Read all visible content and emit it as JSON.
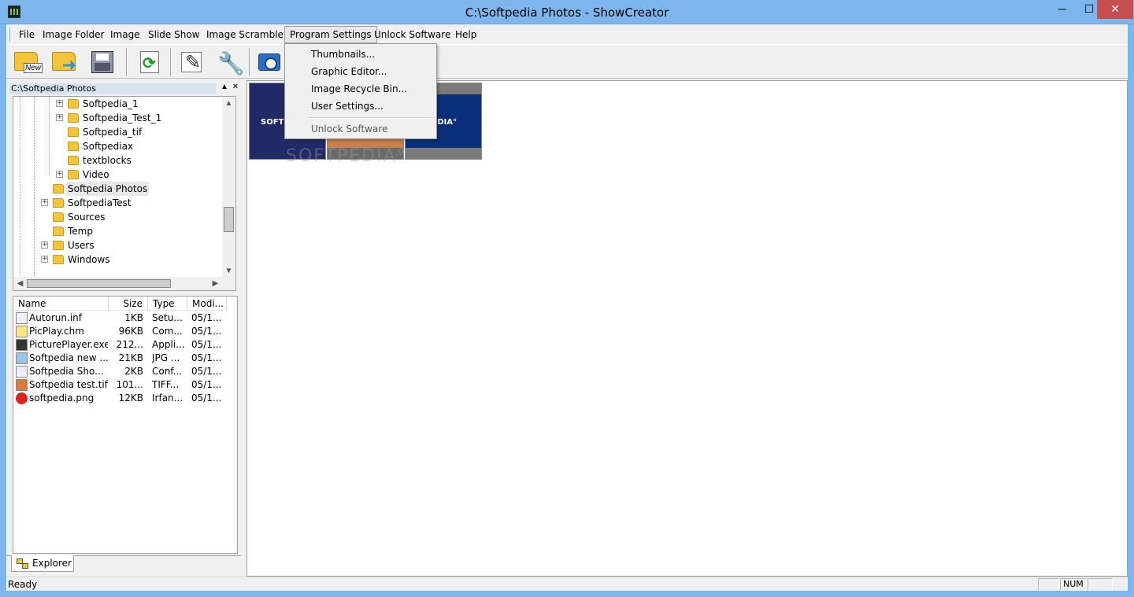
{
  "window": {
    "title": "C:\\Softpedia Photos - ShowCreator",
    "minimize": "─",
    "maximize": "☐",
    "close": "✕"
  },
  "menu": {
    "items": [
      "File",
      "Image Folder",
      "Image",
      "Slide Show",
      "Image Scrambler",
      "Program Settings",
      "Unlock Software",
      "Help"
    ],
    "open_menu": "Program Settings"
  },
  "dropdown": {
    "items": [
      "Thumbnails...",
      "Graphic Editor...",
      "Image Recycle Bin...",
      "User Settings...",
      "Unlock Software"
    ]
  },
  "toolbar": {
    "new_label": "New",
    "icons": [
      "new-folder-icon",
      "open-folder-icon",
      "save-disk-icon",
      "refresh-icon",
      "edit-icon",
      "settings-wrench-icon",
      "camera-slideshow-icon"
    ]
  },
  "tree": {
    "header": "C:\\Softpedia Photos",
    "pin": "▲",
    "close": "✕",
    "items": [
      {
        "label": "Softpedia_1",
        "expandable": true,
        "level": 2
      },
      {
        "label": "Softpedia_Test_1",
        "expandable": true,
        "level": 2
      },
      {
        "label": "Softpedia_tif",
        "expandable": false,
        "level": 2
      },
      {
        "label": "Softpediax",
        "expandable": false,
        "level": 2
      },
      {
        "label": "textblocks",
        "expandable": false,
        "level": 2
      },
      {
        "label": "Video",
        "expandable": true,
        "level": 2
      },
      {
        "label": "Softpedia Photos",
        "expandable": false,
        "level": 1,
        "selected": true
      },
      {
        "label": "SoftpediaTest",
        "expandable": true,
        "level": 1
      },
      {
        "label": "Sources",
        "expandable": false,
        "level": 1
      },
      {
        "label": "Temp",
        "expandable": false,
        "level": 1
      },
      {
        "label": "Users",
        "expandable": true,
        "level": 1
      },
      {
        "label": "Windows",
        "expandable": true,
        "level": 1
      }
    ]
  },
  "files": {
    "columns": [
      "Name",
      "Size",
      "Type",
      "Modi..."
    ],
    "rows": [
      {
        "name": "Autorun.inf",
        "size": "1KB",
        "type": "Setu...",
        "modified": "05/1...",
        "icon": "settings-file-icon"
      },
      {
        "name": "PicPlay.chm",
        "size": "96KB",
        "type": "Com...",
        "modified": "05/1...",
        "icon": "help-file-icon"
      },
      {
        "name": "PicturePlayer.exe",
        "size": "212...",
        "type": "Appli...",
        "modified": "05/1...",
        "icon": "film-app-icon"
      },
      {
        "name": "Softpedia new ...",
        "size": "21KB",
        "type": "JPG ...",
        "modified": "05/1...",
        "icon": "jpg-image-icon"
      },
      {
        "name": "Softpedia Sho...",
        "size": "2KB",
        "type": "Conf...",
        "modified": "05/1...",
        "icon": "config-file-icon"
      },
      {
        "name": "Softpedia test.tif",
        "size": "101...",
        "type": "TIFF...",
        "modified": "05/1...",
        "icon": "tif-image-icon"
      },
      {
        "name": "softpedia.png",
        "size": "12KB",
        "type": "Irfan...",
        "modified": "05/1...",
        "icon": "png-image-icon"
      }
    ]
  },
  "tabs": [
    "Explorer"
  ],
  "thumbnails": [
    {
      "brand": "SOFT",
      "bg": "#1f2a66",
      "frame": "#1f2a66"
    },
    {
      "brand": "",
      "bg": "#c8814a",
      "frame": "#6a6a6a"
    },
    {
      "brand": "OFTPEDIA°",
      "bg": "#0a2f7a",
      "frame": "#7a7a7a"
    }
  ],
  "watermark": "SOFTPEDIA°",
  "status": {
    "text": "Ready",
    "num": "NUM"
  },
  "colors": {
    "titlebar": "#7cb6ec",
    "close_button": "#c7504f",
    "folder": "#f3c53c"
  }
}
